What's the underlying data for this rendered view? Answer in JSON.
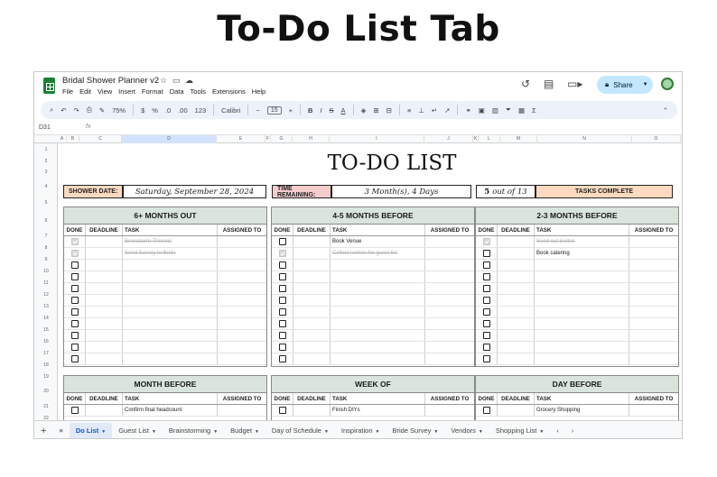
{
  "hero_title": "To-Do List Tab",
  "app": {
    "doc_name": "Bridal Shower Planner v2",
    "menu": [
      "File",
      "Edit",
      "View",
      "Insert",
      "Format",
      "Data",
      "Tools",
      "Extensions",
      "Help"
    ],
    "share_label": "Share",
    "icons": [
      "history-icon",
      "comment-icon",
      "video-icon",
      "star-icon",
      "folder-icon",
      "cloud-icon"
    ]
  },
  "toolbar": {
    "zoom": "75%",
    "currency": "$",
    "percent": "%",
    "decimal_less": ".0",
    "decimal_more": ".00",
    "number_format": "123",
    "font": "Calibri",
    "font_size": "15"
  },
  "formula_bar": {
    "cell_ref": "D31",
    "fx": "fx"
  },
  "grid": {
    "columns": [
      "A",
      "B",
      "C",
      "D",
      "E",
      "F",
      "G",
      "H",
      "I",
      "J",
      "K",
      "L",
      "M",
      "N",
      "O"
    ],
    "rows": [
      "1",
      "2",
      "3",
      "4",
      "5",
      "6",
      "7",
      "8",
      "9",
      "10",
      "11",
      "12",
      "13",
      "14",
      "15",
      "16",
      "17",
      "18",
      "19",
      "20",
      "21",
      "22"
    ]
  },
  "sheet": {
    "title": "TO-DO LIST",
    "shower_date_label": "SHOWER DATE:",
    "shower_date": "Saturday, September 28, 2024",
    "time_remaining_label": "TIME REMAINING:",
    "time_remaining": "3 Month(s), 4 Days",
    "tasks_done": "5",
    "tasks_total_text": "out of 13",
    "tasks_complete_label": "TASKS COMPLETE",
    "headers": {
      "done": "DONE",
      "deadline": "DEADLINE",
      "task": "TASK",
      "assigned": "ASSIGNED TO"
    },
    "cards": [
      {
        "title": "6+ MONTHS OUT",
        "rows": [
          {
            "done": true,
            "task": "Brainstorm Themes"
          },
          {
            "done": true,
            "task": "Send Survey to Bride"
          },
          {
            "done": false,
            "task": ""
          },
          {
            "done": false,
            "task": ""
          },
          {
            "done": false,
            "task": ""
          },
          {
            "done": false,
            "task": ""
          },
          {
            "done": false,
            "task": ""
          },
          {
            "done": false,
            "task": ""
          },
          {
            "done": false,
            "task": ""
          },
          {
            "done": false,
            "task": ""
          },
          {
            "done": false,
            "task": ""
          }
        ]
      },
      {
        "title": "4-5 MONTHS BEFORE",
        "rows": [
          {
            "done": false,
            "task": "Book Venue"
          },
          {
            "done": true,
            "task": "Collect names for guest list"
          },
          {
            "done": false,
            "task": ""
          },
          {
            "done": false,
            "task": ""
          },
          {
            "done": false,
            "task": ""
          },
          {
            "done": false,
            "task": ""
          },
          {
            "done": false,
            "task": ""
          },
          {
            "done": false,
            "task": ""
          },
          {
            "done": false,
            "task": ""
          },
          {
            "done": false,
            "task": ""
          },
          {
            "done": false,
            "task": ""
          }
        ]
      },
      {
        "title": "2-3 MONTHS BEFORE",
        "rows": [
          {
            "done": true,
            "task": "Send out invites"
          },
          {
            "done": false,
            "task": "Book catering"
          },
          {
            "done": false,
            "task": ""
          },
          {
            "done": false,
            "task": ""
          },
          {
            "done": false,
            "task": ""
          },
          {
            "done": false,
            "task": ""
          },
          {
            "done": false,
            "task": ""
          },
          {
            "done": false,
            "task": ""
          },
          {
            "done": false,
            "task": ""
          },
          {
            "done": false,
            "task": ""
          },
          {
            "done": false,
            "task": ""
          }
        ]
      },
      {
        "title": "MONTH BEFORE",
        "rows": [
          {
            "done": false,
            "task": "Confirm final headcount"
          }
        ]
      },
      {
        "title": "WEEK OF",
        "rows": [
          {
            "done": false,
            "task": "Finish DIYs"
          }
        ]
      },
      {
        "title": "DAY BEFORE",
        "rows": [
          {
            "done": false,
            "task": "Grocery Shopping"
          }
        ]
      }
    ]
  },
  "tabs": [
    "Do List",
    "Guest List",
    "Brainstorming",
    "Budget",
    "Day of Schedule",
    "Inspiration",
    "Bride Survey",
    "Vendors",
    "Shopping List"
  ],
  "colors": {
    "card_header": "#d9e5dc",
    "shower_date_bg": "#fdd9bf",
    "time_remaining_bg": "#f4cccc",
    "share_bg": "#c2e7ff"
  }
}
